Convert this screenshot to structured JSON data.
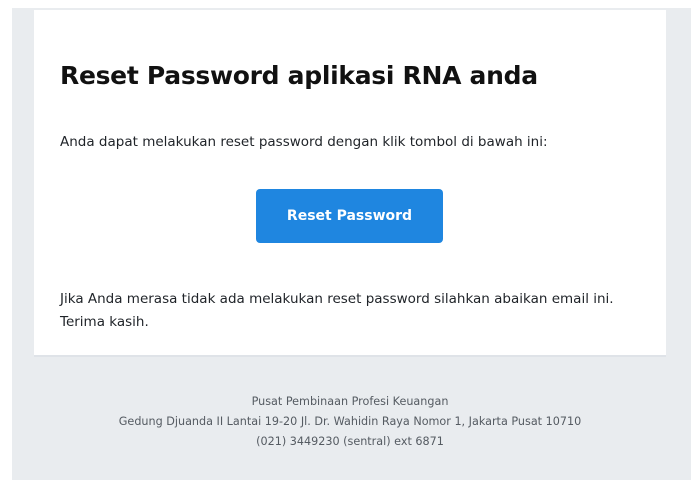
{
  "email": {
    "title": "Reset Password aplikasi RNA anda",
    "intro": "Anda dapat melakukan reset password dengan klik tombol di bawah ini:",
    "button_label": "Reset Password",
    "note_line1": "Jika Anda merasa tidak ada melakukan reset password silahkan abaikan email ini.",
    "note_line2": "Terima kasih."
  },
  "footer": {
    "org": "Pusat Pembinaan Profesi Keuangan",
    "address": "Gedung Djuanda II Lantai 19-20 Jl. Dr. Wahidin Raya Nomor 1, Jakarta Pusat 10710",
    "phone": "(021) 3449230 (sentral) ext 6871"
  },
  "colors": {
    "button": "#1f86e0",
    "background": "#e9ecef"
  }
}
